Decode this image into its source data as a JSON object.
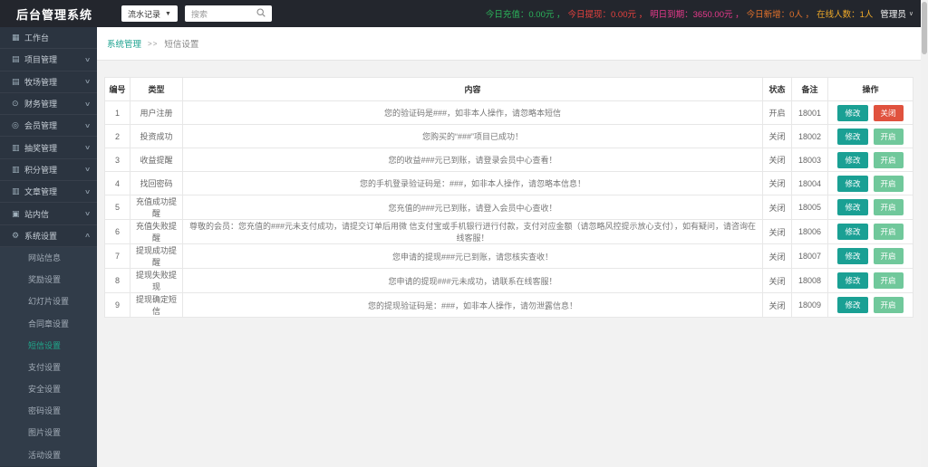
{
  "header": {
    "title": "后台管理系统",
    "nav_select": {
      "value": "流水记录"
    },
    "search": {
      "placeholder": "搜索"
    },
    "stats": [
      {
        "name": "today-recharge",
        "label": "今日充值",
        "value": "0.00元",
        "color": "#2BB55B"
      },
      {
        "name": "today-withdraw",
        "label": "今日提现",
        "value": "0.00元",
        "color": "#E7413E"
      },
      {
        "name": "tomorrow-due",
        "label": "明日到期",
        "value": "3650.00元",
        "color": "#E83A8C"
      },
      {
        "name": "today-new",
        "label": "今日新增",
        "value": "0人",
        "color": "#E2712B"
      },
      {
        "name": "online-count",
        "label": "在线人数",
        "value": "1人",
        "color": "#EFA929"
      }
    ],
    "stat_separator": "，",
    "admin_label": "管理员"
  },
  "sidebar": {
    "items": [
      {
        "name": "workbench",
        "label": "工作台",
        "icon": "dashboard-icon",
        "chevron": null
      },
      {
        "name": "project",
        "label": "项目管理",
        "icon": "folder-icon",
        "chevron": "down"
      },
      {
        "name": "ranch",
        "label": "牧场管理",
        "icon": "folder-icon",
        "chevron": "down"
      },
      {
        "name": "finance",
        "label": "财务管理",
        "icon": "finance-icon",
        "chevron": "down"
      },
      {
        "name": "member",
        "label": "会员管理",
        "icon": "member-icon",
        "chevron": "down"
      },
      {
        "name": "lottery",
        "label": "抽奖管理",
        "icon": "document-icon",
        "chevron": "down"
      },
      {
        "name": "points",
        "label": "积分管理",
        "icon": "document-icon",
        "chevron": "down"
      },
      {
        "name": "article",
        "label": "文章管理",
        "icon": "document-icon",
        "chevron": "down"
      },
      {
        "name": "mail",
        "label": "站内信",
        "icon": "mail-icon",
        "chevron": "down"
      },
      {
        "name": "system",
        "label": "系统设置",
        "icon": "gear-icon",
        "chevron": "up"
      }
    ],
    "submenu": [
      {
        "name": "site-info",
        "label": "网站信息",
        "active": false
      },
      {
        "name": "reward",
        "label": "奖励设置",
        "active": false
      },
      {
        "name": "slideshow",
        "label": "幻灯片设置",
        "active": false
      },
      {
        "name": "contract-seal",
        "label": "合同章设置",
        "active": false
      },
      {
        "name": "sms",
        "label": "短信设置",
        "active": true
      },
      {
        "name": "payment",
        "label": "支付设置",
        "active": false
      },
      {
        "name": "security",
        "label": "安全设置",
        "active": false
      },
      {
        "name": "password",
        "label": "密码设置",
        "active": false
      },
      {
        "name": "image",
        "label": "图片设置",
        "active": false
      },
      {
        "name": "activity",
        "label": "活动设置",
        "active": false
      }
    ]
  },
  "breadcrumb": {
    "section": "系统管理",
    "separator": ">>",
    "page": "短信设置"
  },
  "table": {
    "columns": [
      "编号",
      "类型",
      "内容",
      "状态",
      "备注",
      "操作"
    ],
    "rows": [
      {
        "id": "1",
        "type": "用户注册",
        "content": "您的验证码是###，如非本人操作，请忽略本短信",
        "status": "开启",
        "remark": "18001",
        "actions": [
          {
            "name": "edit-button",
            "label": "修改",
            "style": "teal"
          },
          {
            "name": "close-button",
            "label": "关闭",
            "style": "red"
          }
        ]
      },
      {
        "id": "2",
        "type": "投资成功",
        "content": "您购买的“###”项目已成功！",
        "status": "关闭",
        "remark": "18002",
        "actions": [
          {
            "name": "edit-button",
            "label": "修改",
            "style": "teal"
          },
          {
            "name": "open-button",
            "label": "开启",
            "style": "green"
          }
        ]
      },
      {
        "id": "3",
        "type": "收益提醒",
        "content": "您的收益###元已到账，请登录会员中心查看！",
        "status": "关闭",
        "remark": "18003",
        "actions": [
          {
            "name": "edit-button",
            "label": "修改",
            "style": "teal"
          },
          {
            "name": "open-button",
            "label": "开启",
            "style": "green"
          }
        ]
      },
      {
        "id": "4",
        "type": "找回密码",
        "content": "您的手机登录验证码是：###，如非本人操作，请忽略本信息！",
        "status": "关闭",
        "remark": "18004",
        "actions": [
          {
            "name": "edit-button",
            "label": "修改",
            "style": "teal"
          },
          {
            "name": "open-button",
            "label": "开启",
            "style": "green"
          }
        ]
      },
      {
        "id": "5",
        "type": "充值成功提醒",
        "content": "您充值的###元已到账，请登入会员中心查收！",
        "status": "关闭",
        "remark": "18005",
        "actions": [
          {
            "name": "edit-button",
            "label": "修改",
            "style": "teal"
          },
          {
            "name": "open-button",
            "label": "开启",
            "style": "green"
          }
        ]
      },
      {
        "id": "6",
        "type": "充值失败提醒",
        "content": "尊敬的会员：您充值的###元未支付成功，请提交订单后用微 信支付宝或手机银行进行付款，支付对应金额（请忽略风控提示放心支付），如有疑问，请咨询在线客服！",
        "status": "关闭",
        "remark": "18006",
        "actions": [
          {
            "name": "edit-button",
            "label": "修改",
            "style": "teal"
          },
          {
            "name": "open-button",
            "label": "开启",
            "style": "green"
          }
        ]
      },
      {
        "id": "7",
        "type": "提现成功提醒",
        "content": "您申请的提现###元已到账，请您核实查收！",
        "status": "关闭",
        "remark": "18007",
        "actions": [
          {
            "name": "edit-button",
            "label": "修改",
            "style": "teal"
          },
          {
            "name": "open-button",
            "label": "开启",
            "style": "green"
          }
        ]
      },
      {
        "id": "8",
        "type": "提现失败提现",
        "content": "您申请的提现###元未成功，请联系在线客服！",
        "status": "关闭",
        "remark": "18008",
        "actions": [
          {
            "name": "edit-button",
            "label": "修改",
            "style": "teal"
          },
          {
            "name": "open-button",
            "label": "开启",
            "style": "green"
          }
        ]
      },
      {
        "id": "9",
        "type": "提现确定短信",
        "content": "您的提现验证码是：###，如非本人操作，请勿泄露信息！",
        "status": "关闭",
        "remark": "18009",
        "actions": [
          {
            "name": "edit-button",
            "label": "修改",
            "style": "teal"
          },
          {
            "name": "open-button",
            "label": "开启",
            "style": "green"
          }
        ]
      }
    ]
  },
  "colors": {
    "topbar_bg": "#23262D",
    "sidebar_bg": "#2B3440",
    "submenu_bg": "#313C49",
    "accent_teal": "#1AA094",
    "active_menu_teal": "#1FA98C",
    "button_red": "#E0523E",
    "button_green": "#70C89B",
    "content_bg": "#F2F2F2"
  }
}
